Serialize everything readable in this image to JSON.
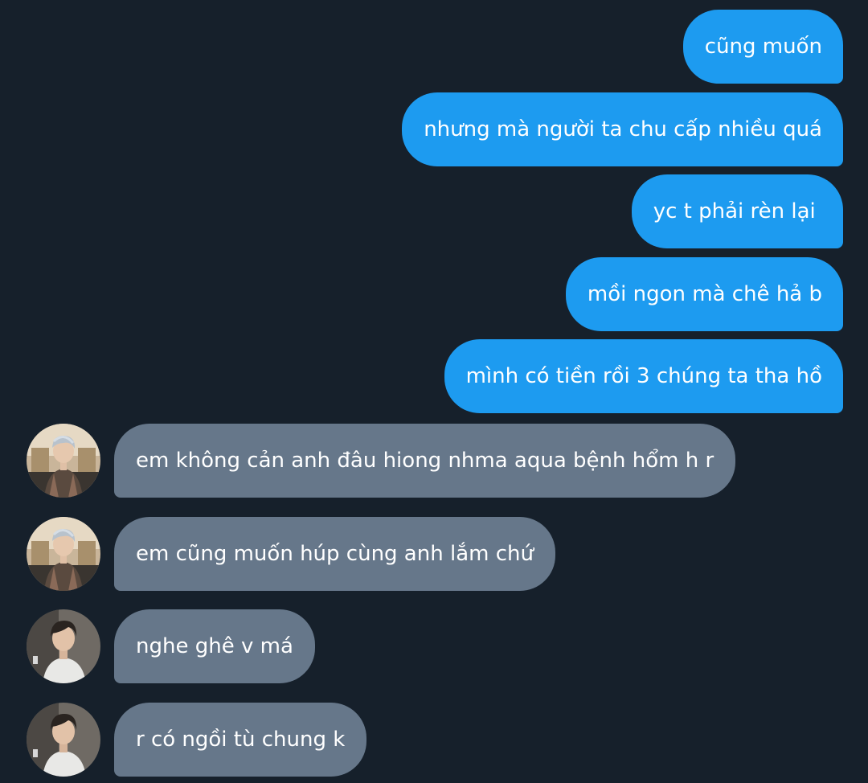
{
  "conversation": {
    "messages": [
      {
        "direction": "sent",
        "text": "cũng muốn"
      },
      {
        "direction": "sent",
        "text": "nhưng mà người ta chu cấp nhiều quá"
      },
      {
        "direction": "sent",
        "text": "yc t phải rèn lại "
      },
      {
        "direction": "sent",
        "text": "mồi ngon mà chê hả b"
      },
      {
        "direction": "sent",
        "text": "mình có tiền rồi 3 chúng ta tha hồ"
      },
      {
        "direction": "received",
        "avatar": "avatar-user-a",
        "text": "em không cản anh đâu hiong nhma aqua bệnh hổm h r"
      },
      {
        "direction": "received",
        "avatar": "avatar-user-a",
        "text": "em cũng muốn húp cùng anh lắm chứ"
      },
      {
        "direction": "received",
        "avatar": "avatar-user-b",
        "text": "nghe ghê v má"
      },
      {
        "direction": "received",
        "avatar": "avatar-user-b",
        "text": "r có ngồi tù chung k"
      }
    ]
  },
  "colors": {
    "background": "#16202b",
    "sent_bubble": "#1d9bf0",
    "received_bubble": "#66778a",
    "text": "#ffffff"
  }
}
